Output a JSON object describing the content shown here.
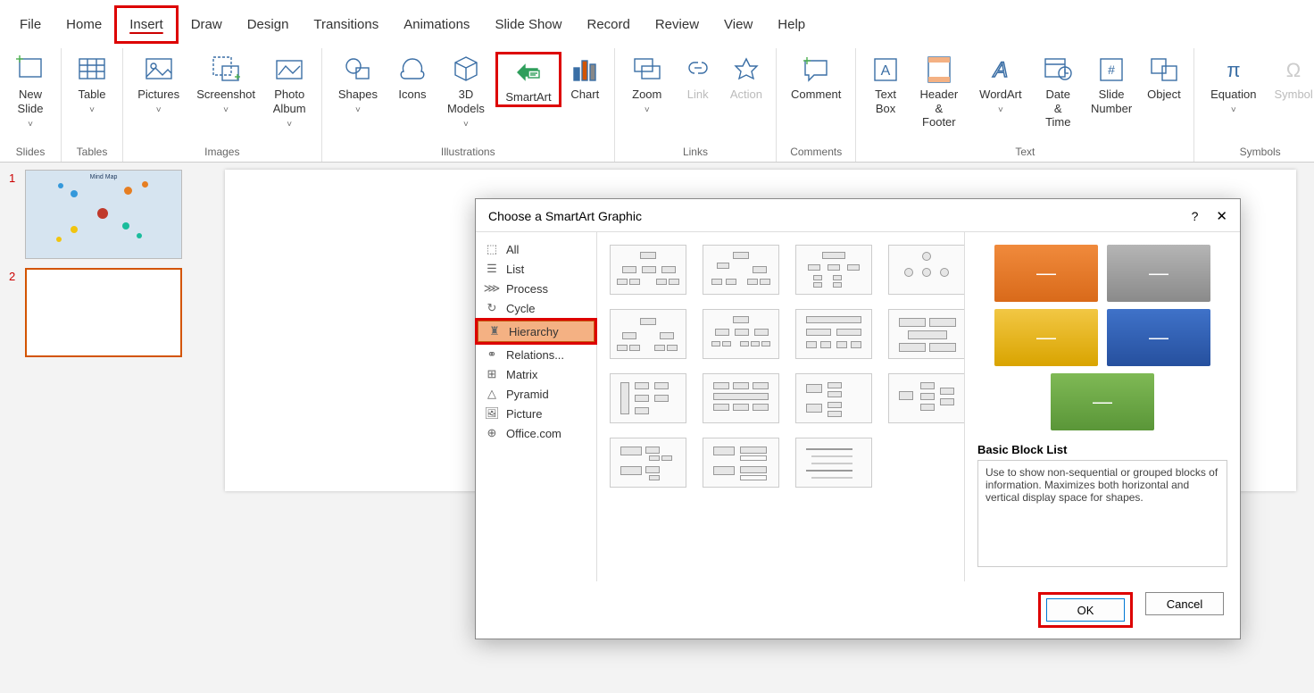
{
  "tabs": {
    "file": "File",
    "home": "Home",
    "insert": "Insert",
    "draw": "Draw",
    "design": "Design",
    "transitions": "Transitions",
    "animations": "Animations",
    "slideshow": "Slide Show",
    "record": "Record",
    "review": "Review",
    "view": "View",
    "help": "Help"
  },
  "ribbon": {
    "new_slide": "New\nSlide",
    "table": "Table",
    "pictures": "Pictures",
    "screenshot": "Screenshot",
    "photo_album": "Photo\nAlbum",
    "shapes": "Shapes",
    "icons": "Icons",
    "models": "3D\nModels",
    "smartart": "SmartArt",
    "chart": "Chart",
    "zoom": "Zoom",
    "link": "Link",
    "action": "Action",
    "comment": "Comment",
    "textbox": "Text\nBox",
    "headerfooter": "Header\n& Footer",
    "wordart": "WordArt",
    "datetime": "Date &\nTime",
    "slidenum": "Slide\nNumber",
    "object": "Object",
    "equation": "Equation",
    "symbol": "Symbol",
    "groups": {
      "slides": "Slides",
      "tables": "Tables",
      "images": "Images",
      "illustrations": "Illustrations",
      "links": "Links",
      "comments": "Comments",
      "text": "Text",
      "symbols": "Symbols"
    }
  },
  "slides": {
    "n1": "1",
    "n2": "2",
    "thumb1_title": "Mind Map"
  },
  "dialog": {
    "title": "Choose a SmartArt Graphic",
    "help": "?",
    "close": "✕",
    "categories": {
      "all": "All",
      "list": "List",
      "process": "Process",
      "cycle": "Cycle",
      "hierarchy": "Hierarchy",
      "relationship": "Relations...",
      "matrix": "Matrix",
      "pyramid": "Pyramid",
      "picture": "Picture",
      "office": "Office.com"
    },
    "preview": {
      "title": "Basic Block List",
      "desc": "Use to show non-sequential or grouped blocks of information. Maximizes both horizontal and vertical display space for shapes.",
      "colors": [
        "#e87722",
        "#9b9b9b",
        "#e6b800",
        "#2f5fb5",
        "#6aa84f"
      ],
      "dash": "—"
    },
    "ok": "OK",
    "cancel": "Cancel"
  }
}
